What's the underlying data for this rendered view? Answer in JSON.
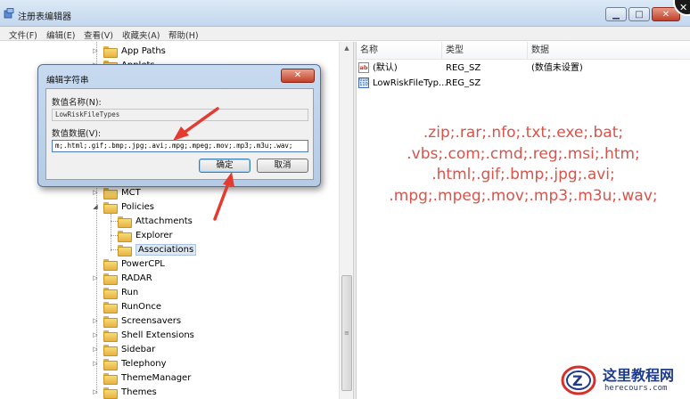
{
  "window": {
    "title": "注册表编辑器",
    "minimize_glyph": "▁",
    "maximize_glyph": "□",
    "close_glyph": "✕"
  },
  "menu": [
    "文件(F)",
    "编辑(E)",
    "查看(V)",
    "收藏夹(A)",
    "帮助(H)"
  ],
  "tree": {
    "items": [
      {
        "label": "App Paths",
        "toggle": "▷"
      },
      {
        "label": "Applets",
        "toggle": "▷"
      },
      {
        "label": "MCT",
        "toggle": "▷"
      },
      {
        "label": "Policies",
        "toggle": "◢"
      },
      {
        "label": "Attachments",
        "toggle": ""
      },
      {
        "label": "Explorer",
        "toggle": ""
      },
      {
        "label": "Associations",
        "toggle": ""
      },
      {
        "label": "PowerCPL",
        "toggle": ""
      },
      {
        "label": "RADAR",
        "toggle": "▷"
      },
      {
        "label": "Run",
        "toggle": ""
      },
      {
        "label": "RunOnce",
        "toggle": ""
      },
      {
        "label": "Screensavers",
        "toggle": "▷"
      },
      {
        "label": "Shell Extensions",
        "toggle": "▷"
      },
      {
        "label": "Sidebar",
        "toggle": "▷"
      },
      {
        "label": "Telephony",
        "toggle": "▷"
      },
      {
        "label": "ThemeManager",
        "toggle": ""
      },
      {
        "label": "Themes",
        "toggle": "▷"
      }
    ]
  },
  "list": {
    "headers": [
      "名称",
      "类型",
      "数据"
    ],
    "rows": [
      {
        "name": "(默认)",
        "type": "REG_SZ",
        "data": "(数值未设置)",
        "icon": "ab-icon"
      },
      {
        "name": "LowRiskFileTyp...",
        "type": "REG_SZ",
        "data": "",
        "icon": "binary-icon"
      }
    ]
  },
  "overlay_lines": [
    ".zip;.rar;.nfo;.txt;.exe;.bat;",
    ".vbs;.com;.cmd;.reg;.msi;.htm;",
    ".html;.gif;.bmp;.jpg;.avi;",
    ".mpg;.mpeg;.mov;.mp3;.m3u;.wav;"
  ],
  "dialog": {
    "title": "编辑字符串",
    "name_label": "数值名称(N):",
    "name_value": "LowRiskFileTypes",
    "data_label": "数值数据(V):",
    "data_value": "m;.html;.gif;.bmp;.jpg;.avi;.mpg;.mpeg;.mov;.mp3;.m3u;.wav;",
    "ok_label": "确定",
    "cancel_label": "取消",
    "close_glyph": "✕"
  },
  "watermark": {
    "cn": "这里教程网",
    "en": "herecours.com"
  },
  "colors": {
    "annotation": "#e53a2f",
    "overlay_text": "#d9534a",
    "watermark": "#1e3c8c"
  }
}
